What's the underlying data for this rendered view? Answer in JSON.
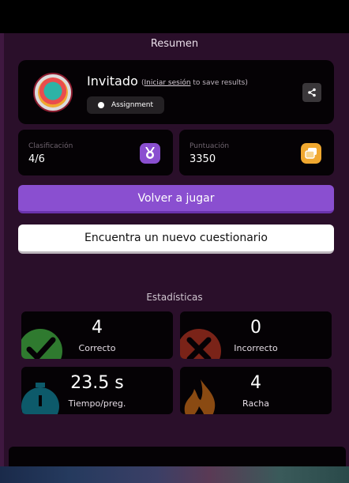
{
  "header": {
    "title": "Resumen"
  },
  "profile": {
    "name": "Invitado",
    "login_prefix": "(",
    "login_link": "Iniciar sesión",
    "login_suffix": " to save results)",
    "assignment_label": "Assignment"
  },
  "ranking": {
    "label": "Clasificación",
    "value": "4/6"
  },
  "score": {
    "label": "Puntuación",
    "value": "3350"
  },
  "actions": {
    "play_again": "Volver a jugar",
    "find_quiz": "Encuentra un nuevo cuestionario"
  },
  "stats": {
    "title": "Estadísticas",
    "items": [
      {
        "value": "4",
        "label": "Correcto",
        "icon": "check-icon"
      },
      {
        "value": "0",
        "label": "Incorrecto",
        "icon": "cross-icon"
      },
      {
        "value": "23.5 s",
        "label": "Tiempo/preg.",
        "icon": "stopwatch-icon"
      },
      {
        "value": "4",
        "label": "Racha",
        "icon": "flame-icon"
      }
    ]
  },
  "colors": {
    "primary": "#8a4fd0",
    "background": "#2a0f2a",
    "card": "#050205",
    "rank_badge": "#8a4fd0",
    "score_badge": "#f0a830",
    "correct": "#2f7a2f",
    "incorrect": "#7a2318",
    "time": "#0d5a6a",
    "streak": "#8a4a12"
  }
}
